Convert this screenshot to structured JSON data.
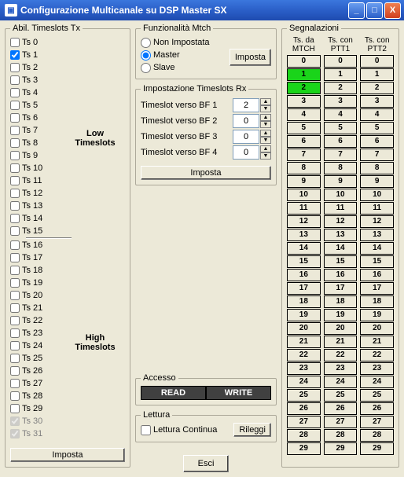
{
  "window": {
    "title": "Configurazione Multicanale su DSP Master SX"
  },
  "timeslots": {
    "legend": "Abil. Timeslots Tx",
    "low_label_1": "Low",
    "low_label_2": "Timeslots",
    "high_label_1": "High",
    "high_label_2": "Timeslots",
    "imposta_btn": "Imposta",
    "items": [
      {
        "label": "Ts 0",
        "checked": false,
        "disabled": false
      },
      {
        "label": "Ts 1",
        "checked": true,
        "disabled": false
      },
      {
        "label": "Ts 2",
        "checked": false,
        "disabled": false
      },
      {
        "label": "Ts 3",
        "checked": false,
        "disabled": false
      },
      {
        "label": "Ts 4",
        "checked": false,
        "disabled": false
      },
      {
        "label": "Ts 5",
        "checked": false,
        "disabled": false
      },
      {
        "label": "Ts 6",
        "checked": false,
        "disabled": false
      },
      {
        "label": "Ts 7",
        "checked": false,
        "disabled": false
      },
      {
        "label": "Ts 8",
        "checked": false,
        "disabled": false
      },
      {
        "label": "Ts 9",
        "checked": false,
        "disabled": false
      },
      {
        "label": "Ts 10",
        "checked": false,
        "disabled": false
      },
      {
        "label": "Ts 11",
        "checked": false,
        "disabled": false
      },
      {
        "label": "Ts 12",
        "checked": false,
        "disabled": false
      },
      {
        "label": "Ts 13",
        "checked": false,
        "disabled": false
      },
      {
        "label": "Ts 14",
        "checked": false,
        "disabled": false
      },
      {
        "label": "Ts 15",
        "checked": false,
        "disabled": false
      },
      {
        "label": "Ts 16",
        "checked": false,
        "disabled": false
      },
      {
        "label": "Ts 17",
        "checked": false,
        "disabled": false
      },
      {
        "label": "Ts 18",
        "checked": false,
        "disabled": false
      },
      {
        "label": "Ts 19",
        "checked": false,
        "disabled": false
      },
      {
        "label": "Ts 20",
        "checked": false,
        "disabled": false
      },
      {
        "label": "Ts 21",
        "checked": false,
        "disabled": false
      },
      {
        "label": "Ts 22",
        "checked": false,
        "disabled": false
      },
      {
        "label": "Ts 23",
        "checked": false,
        "disabled": false
      },
      {
        "label": "Ts 24",
        "checked": false,
        "disabled": false
      },
      {
        "label": "Ts 25",
        "checked": false,
        "disabled": false
      },
      {
        "label": "Ts 26",
        "checked": false,
        "disabled": false
      },
      {
        "label": "Ts 27",
        "checked": false,
        "disabled": false
      },
      {
        "label": "Ts 28",
        "checked": false,
        "disabled": false
      },
      {
        "label": "Ts 29",
        "checked": false,
        "disabled": false
      },
      {
        "label": "Ts 30",
        "checked": true,
        "disabled": true
      },
      {
        "label": "Ts 31",
        "checked": true,
        "disabled": true
      }
    ]
  },
  "mtch": {
    "legend": "Funzionalità Mtch",
    "opt_none": "Non Impostata",
    "opt_master": "Master",
    "opt_slave": "Slave",
    "selected": "master",
    "imposta_btn": "Imposta"
  },
  "rx": {
    "legend": "Impostazione Timeslots Rx",
    "rows": [
      {
        "label": "Timeslot verso BF 1",
        "value": "2"
      },
      {
        "label": "Timeslot verso BF 2",
        "value": "0"
      },
      {
        "label": "Timeslot verso BF 3",
        "value": "0"
      },
      {
        "label": "Timeslot verso BF 4",
        "value": "0"
      }
    ],
    "imposta_btn": "Imposta"
  },
  "access": {
    "legend": "Accesso",
    "read": "READ",
    "write": "WRITE"
  },
  "lettura": {
    "legend": "Lettura",
    "continua_label": "Lettura Continua",
    "continua_checked": false,
    "rileggi_btn": "Rileggi"
  },
  "esci_btn": "Esci",
  "segnalazioni": {
    "legend": "Segnalazioni",
    "head1": "Ts. da MTCH",
    "head2": "Ts. con PTT1",
    "head3": "Ts. con PTT2",
    "col1": [
      {
        "v": "0",
        "g": false
      },
      {
        "v": "1",
        "g": true
      },
      {
        "v": "2",
        "g": true
      },
      {
        "v": "3",
        "g": false
      },
      {
        "v": "4",
        "g": false
      },
      {
        "v": "5",
        "g": false
      },
      {
        "v": "6",
        "g": false
      },
      {
        "v": "7",
        "g": false
      },
      {
        "v": "8",
        "g": false
      },
      {
        "v": "9",
        "g": false
      },
      {
        "v": "10",
        "g": false
      },
      {
        "v": "11",
        "g": false
      },
      {
        "v": "12",
        "g": false
      },
      {
        "v": "13",
        "g": false
      },
      {
        "v": "14",
        "g": false
      },
      {
        "v": "15",
        "g": false
      },
      {
        "v": "16",
        "g": false
      },
      {
        "v": "17",
        "g": false
      },
      {
        "v": "18",
        "g": false
      },
      {
        "v": "19",
        "g": false
      },
      {
        "v": "20",
        "g": false
      },
      {
        "v": "21",
        "g": false
      },
      {
        "v": "22",
        "g": false
      },
      {
        "v": "23",
        "g": false
      },
      {
        "v": "24",
        "g": false
      },
      {
        "v": "25",
        "g": false
      },
      {
        "v": "26",
        "g": false
      },
      {
        "v": "27",
        "g": false
      },
      {
        "v": "28",
        "g": false
      },
      {
        "v": "29",
        "g": false
      }
    ],
    "col2": [
      {
        "v": "0"
      },
      {
        "v": "1"
      },
      {
        "v": "2"
      },
      {
        "v": "3"
      },
      {
        "v": "4"
      },
      {
        "v": "5"
      },
      {
        "v": "6"
      },
      {
        "v": "7"
      },
      {
        "v": "8"
      },
      {
        "v": "9"
      },
      {
        "v": "10"
      },
      {
        "v": "11"
      },
      {
        "v": "12"
      },
      {
        "v": "13"
      },
      {
        "v": "14"
      },
      {
        "v": "15"
      },
      {
        "v": "16"
      },
      {
        "v": "17"
      },
      {
        "v": "18"
      },
      {
        "v": "19"
      },
      {
        "v": "20"
      },
      {
        "v": "21"
      },
      {
        "v": "22"
      },
      {
        "v": "23"
      },
      {
        "v": "24"
      },
      {
        "v": "25"
      },
      {
        "v": "26"
      },
      {
        "v": "27"
      },
      {
        "v": "28"
      },
      {
        "v": "29"
      }
    ],
    "col3": [
      {
        "v": "0"
      },
      {
        "v": "1"
      },
      {
        "v": "2"
      },
      {
        "v": "3"
      },
      {
        "v": "4"
      },
      {
        "v": "5"
      },
      {
        "v": "6"
      },
      {
        "v": "7"
      },
      {
        "v": "8"
      },
      {
        "v": "9"
      },
      {
        "v": "10"
      },
      {
        "v": "11"
      },
      {
        "v": "12"
      },
      {
        "v": "13"
      },
      {
        "v": "14"
      },
      {
        "v": "15"
      },
      {
        "v": "16"
      },
      {
        "v": "17"
      },
      {
        "v": "18"
      },
      {
        "v": "19"
      },
      {
        "v": "20"
      },
      {
        "v": "21"
      },
      {
        "v": "22"
      },
      {
        "v": "23"
      },
      {
        "v": "24"
      },
      {
        "v": "25"
      },
      {
        "v": "26"
      },
      {
        "v": "27"
      },
      {
        "v": "28"
      },
      {
        "v": "29"
      }
    ]
  }
}
